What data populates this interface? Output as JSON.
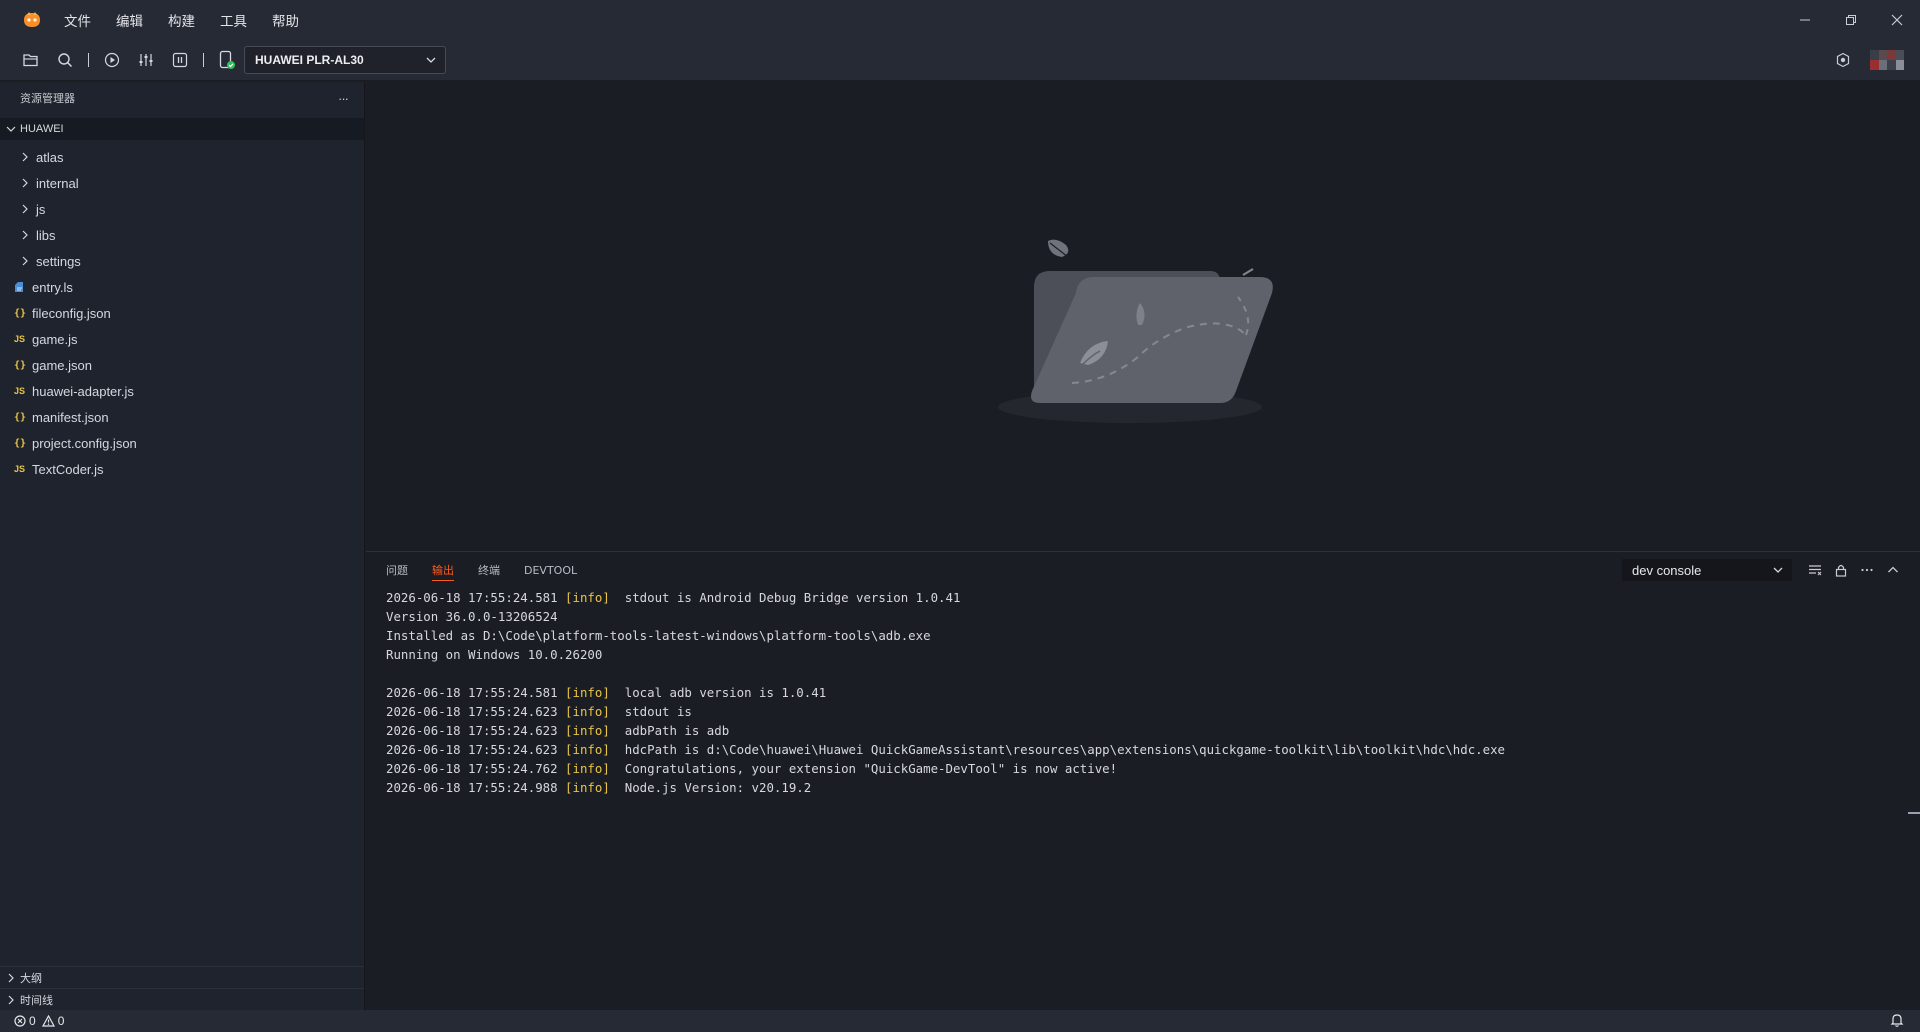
{
  "menu": [
    "文件",
    "编辑",
    "构建",
    "工具",
    "帮助"
  ],
  "toolbar": {
    "device": "HUAWEI PLR-AL30"
  },
  "sidebar": {
    "title": "资源管理器",
    "more": "···",
    "root": "HUAWEI",
    "items": [
      {
        "label": "atlas",
        "type": "folder"
      },
      {
        "label": "internal",
        "type": "folder"
      },
      {
        "label": "js",
        "type": "folder"
      },
      {
        "label": "libs",
        "type": "folder"
      },
      {
        "label": "settings",
        "type": "folder"
      },
      {
        "label": "entry.ls",
        "type": "ls"
      },
      {
        "label": "fileconfig.json",
        "type": "json"
      },
      {
        "label": "game.js",
        "type": "js"
      },
      {
        "label": "game.json",
        "type": "json"
      },
      {
        "label": "huawei-adapter.js",
        "type": "js"
      },
      {
        "label": "manifest.json",
        "type": "json"
      },
      {
        "label": "project.config.json",
        "type": "json"
      },
      {
        "label": "TextCoder.js",
        "type": "js"
      }
    ],
    "json_glyph": "{}",
    "js_glyph": "JS",
    "outline": "大纲",
    "timeline": "时间线"
  },
  "panel": {
    "tabs": [
      "问题",
      "输出",
      "终端",
      "DEVTOOL"
    ],
    "active_tab": 1,
    "channel": "dev console",
    "log": [
      {
        "ts": "2026-06-18 17:55:24.581",
        "tag": "[info]",
        "msg": "stdout is Android Debug Bridge version 1.0.41"
      },
      {
        "ts": "",
        "tag": "",
        "msg": "Version 36.0.0-13206524"
      },
      {
        "ts": "",
        "tag": "",
        "msg": "Installed as D:\\Code\\platform-tools-latest-windows\\platform-tools\\adb.exe"
      },
      {
        "ts": "",
        "tag": "",
        "msg": "Running on Windows 10.0.26200"
      },
      {
        "ts": "",
        "tag": "",
        "msg": ""
      },
      {
        "ts": "2026-06-18 17:55:24.581",
        "tag": "[info]",
        "msg": "local adb version is 1.0.41"
      },
      {
        "ts": "2026-06-18 17:55:24.623",
        "tag": "[info]",
        "msg": "stdout is"
      },
      {
        "ts": "2026-06-18 17:55:24.623",
        "tag": "[info]",
        "msg": "adbPath is adb"
      },
      {
        "ts": "2026-06-18 17:55:24.623",
        "tag": "[info]",
        "msg": "hdcPath is d:\\Code\\huawei\\Huawei QuickGameAssistant\\resources\\app\\extensions\\quickgame-toolkit\\lib\\toolkit\\hdc\\hdc.exe"
      },
      {
        "ts": "2026-06-18 17:55:24.762",
        "tag": "[info]",
        "msg": "Congratulations, your extension \"QuickGame-DevTool\" is now active!"
      },
      {
        "ts": "2026-06-18 17:55:24.988",
        "tag": "[info]",
        "msg": "Node.js Version: v20.19.2"
      }
    ]
  },
  "status": {
    "errors": "0",
    "warnings": "0"
  },
  "colors": {
    "accent": "#ff5a1f",
    "tag": "#e8c547"
  }
}
